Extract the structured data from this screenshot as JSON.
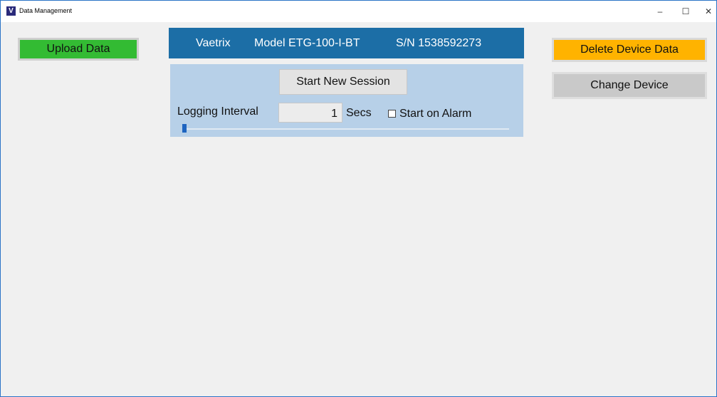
{
  "window": {
    "title": "Data Management",
    "app_icon": "V",
    "controls": {
      "minimize": "–",
      "maximize": "☐",
      "close": "✕"
    }
  },
  "toolbar": {
    "upload_label": "Upload Data",
    "delete_label": "Delete Device Data",
    "change_label": "Change Device"
  },
  "device": {
    "brand": "Vaetrix",
    "model": "Model ETG-100-I-BT",
    "serial": "S/N 1538592273"
  },
  "session": {
    "start_label": "Start New Session",
    "interval_label": "Logging Interval",
    "interval_value": "1",
    "interval_unit": "Secs",
    "start_on_alarm_label": "Start on Alarm",
    "start_on_alarm_checked": false,
    "slider_level": 0
  },
  "colors": {
    "upload": "#33bb33",
    "delete": "#ffb300",
    "change": "#c9c9c9",
    "header": "#1c6ea6",
    "panel": "#b7d0e8"
  }
}
